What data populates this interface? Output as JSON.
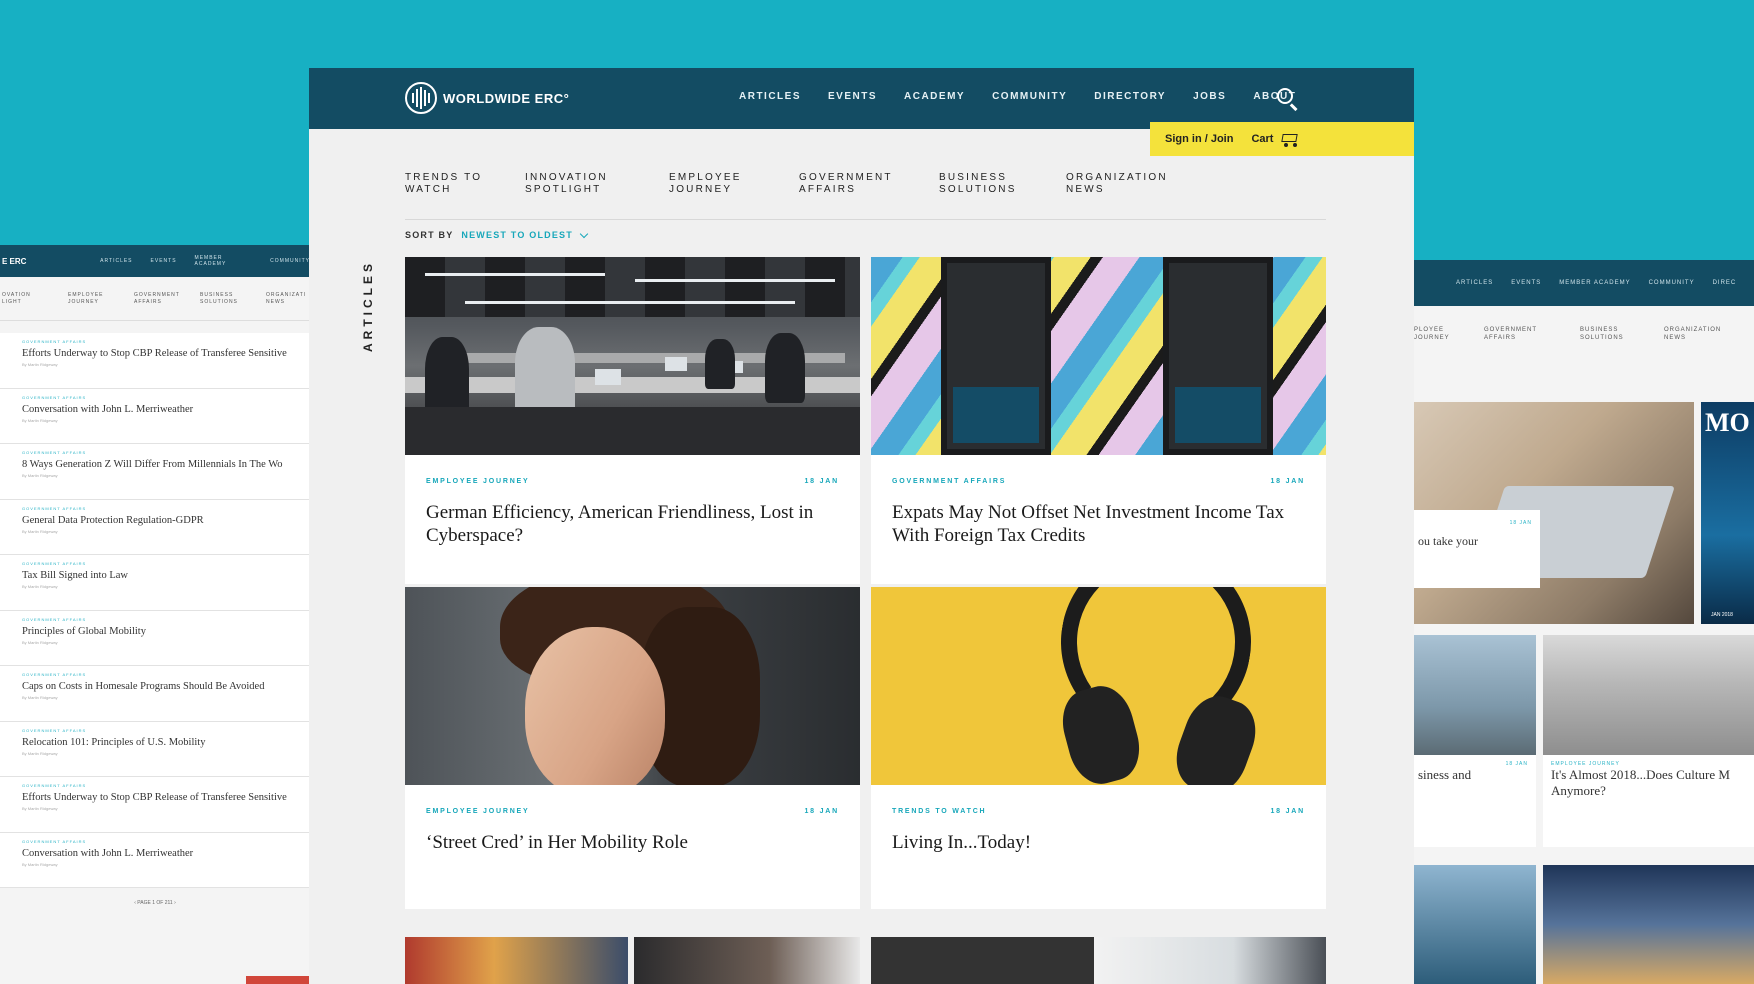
{
  "left_page": {
    "logo": "E ERC",
    "nav": [
      "ARTICLES",
      "EVENTS",
      "MEMBER ACADEMY",
      "COMMUNITY"
    ],
    "categories": [
      "OVATION LIGHT",
      "EMPLOYEE JOURNEY",
      "GOVERNMENT AFFAIRS",
      "BUSINESS SOLUTIONS",
      "ORGANIZATI NEWS"
    ],
    "items": [
      {
        "tag": "GOVERNMENT AFFAIRS",
        "title": "Efforts Underway to Stop CBP Release of Transferee Sensitive",
        "by": "By Martin Ridgeway"
      },
      {
        "tag": "GOVERNMENT AFFAIRS",
        "title": "Conversation with John L. Merriweather",
        "by": "By Martin Ridgeway"
      },
      {
        "tag": "GOVERNMENT AFFAIRS",
        "title": "8 Ways Generation Z Will Differ From Millennials In The Wo",
        "by": "By Martin Ridgeway"
      },
      {
        "tag": "GOVERNMENT AFFAIRS",
        "title": "General Data Protection Regulation-GDPR",
        "by": "By Martin Ridgeway"
      },
      {
        "tag": "GOVERNMENT AFFAIRS",
        "title": "Tax Bill Signed into Law",
        "by": "By Martin Ridgeway"
      },
      {
        "tag": "GOVERNMENT AFFAIRS",
        "title": "Principles of Global Mobility",
        "by": "By Martin Ridgeway"
      },
      {
        "tag": "GOVERNMENT AFFAIRS",
        "title": "Caps on Costs in Homesale Programs Should Be Avoided",
        "by": "By Martin Ridgeway"
      },
      {
        "tag": "GOVERNMENT AFFAIRS",
        "title": "Relocation 101: Principles of U.S. Mobility",
        "by": "By Martin Ridgeway"
      },
      {
        "tag": "GOVERNMENT AFFAIRS",
        "title": "Efforts Underway to Stop CBP Release of Transferee Sensitive",
        "by": "By Martin Ridgeway"
      },
      {
        "tag": "GOVERNMENT AFFAIRS",
        "title": "Conversation with John L. Merriweather",
        "by": "By Martin Ridgeway"
      }
    ],
    "pager": "‹  PAGE 1 OF 211  ›"
  },
  "right_page": {
    "nav": [
      "ARTICLES",
      "EVENTS",
      "MEMBER ACADEMY",
      "COMMUNITY",
      "DIREC"
    ],
    "categories": [
      "PLOYEE JOURNEY",
      "GOVERNMENT AFFAIRS",
      "BUSINESS SOLUTIONS",
      "ORGANIZATION NEWS"
    ],
    "hero_card": {
      "date": "18 JAN",
      "title": "ou take your"
    },
    "magazine": {
      "title": "MO",
      "date": "JAN 2018"
    },
    "tile_left": {
      "date": "18 JAN",
      "title": "siness and"
    },
    "tile_right": {
      "tag": "EMPLOYEE JOURNEY",
      "title": "It's Almost 2018...Does Culture M Anymore?"
    }
  },
  "main": {
    "logo_text": "WORLDWIDE ERC°",
    "nav": [
      "ARTICLES",
      "EVENTS",
      "ACADEMY",
      "COMMUNITY",
      "DIRECTORY",
      "JOBS",
      "ABOUT"
    ],
    "account": {
      "signin": "Sign in / Join",
      "cart": "Cart"
    },
    "categories": [
      "TRENDS TO\nWATCH",
      "INNOVATION\nSPOTLIGHT",
      "EMPLOYEE\nJOURNEY",
      "GOVERNMENT\nAFFAIRS",
      "BUSINESS\nSOLUTIONS",
      "ORGANIZATION\nNEWS"
    ],
    "sort": {
      "label": "SORT BY",
      "value": "NEWEST TO OLDEST"
    },
    "section_label": "ARTICLES",
    "cards": [
      {
        "tag": "EMPLOYEE JOURNEY",
        "date": "18 JAN",
        "title": "German Efficiency, American Friendliness, Lost in Cyberspace?"
      },
      {
        "tag": "GOVERNMENT AFFAIRS",
        "date": "18 JAN",
        "title": "Expats May Not Offset Net Investment Income Tax With Foreign Tax Credits"
      },
      {
        "tag": "EMPLOYEE JOURNEY",
        "date": "18 JAN",
        "title": "‘Street Cred’ in Her Mobility Role"
      },
      {
        "tag": "TRENDS TO WATCH",
        "date": "18 JAN",
        "title": "Living In...Today!"
      }
    ]
  },
  "colors": {
    "background": "#17b0c3",
    "nav": "#134c63",
    "accent": "#17a7ba",
    "account_bar": "#f4e23b"
  }
}
